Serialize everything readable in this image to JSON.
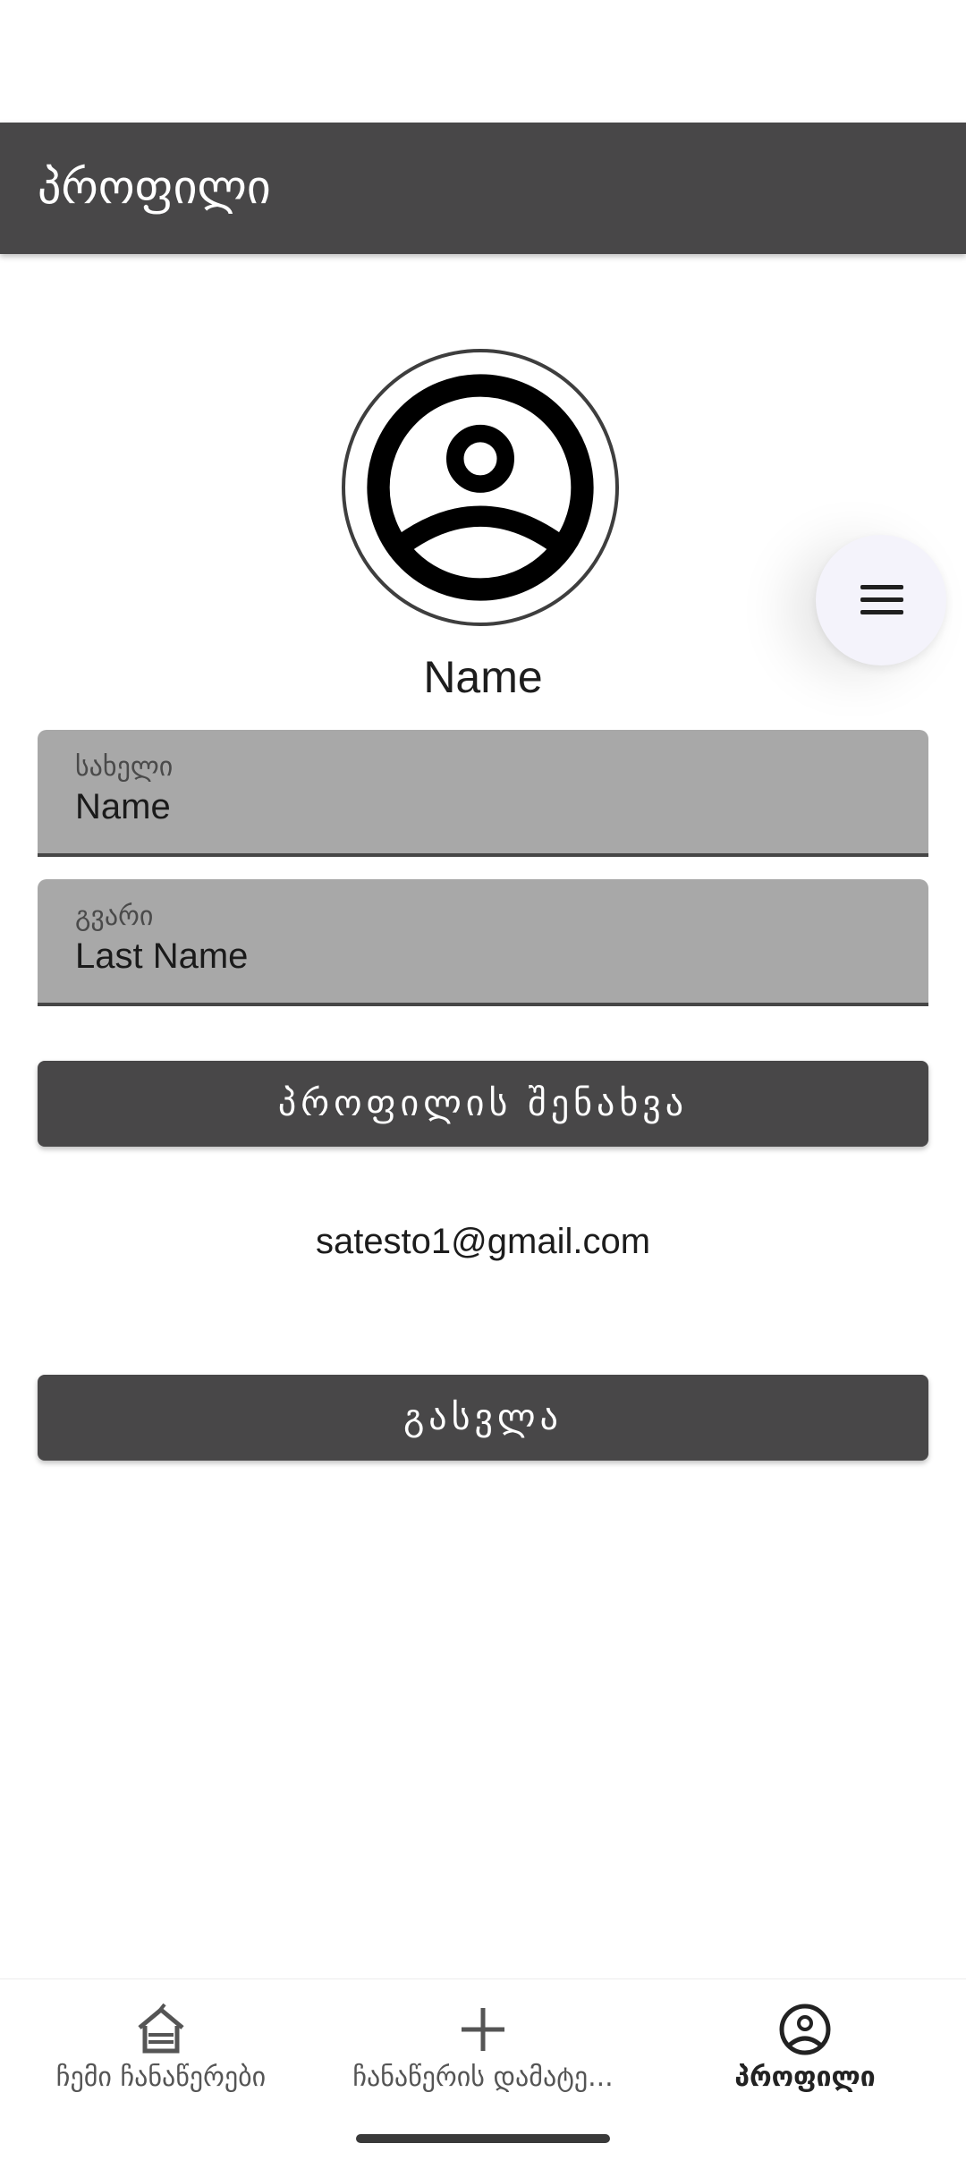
{
  "app_bar": {
    "title": "პროფილი"
  },
  "profile": {
    "display_name": "Name",
    "first_name": {
      "label": "სახელი",
      "value": "Name"
    },
    "last_name": {
      "label": "გვარი",
      "value": "Last Name"
    },
    "save_button_label": "პროფილის შენახვა",
    "email": "satesto1@gmail.com",
    "logout_button_label": "გასვლა"
  },
  "fab": {
    "icon": "menu-icon"
  },
  "bottom_nav": {
    "items": [
      {
        "label": "ჩემი ჩანაწერები",
        "icon": "home-icon",
        "active": false
      },
      {
        "label": "ჩანაწერის დამატე...",
        "icon": "add-icon",
        "active": false
      },
      {
        "label": "პროფილი",
        "icon": "account-circle-icon",
        "active": true
      }
    ]
  },
  "colors": {
    "app_bar": "#484748",
    "field_background": "#a8a8a8",
    "button": "#484748",
    "fab_background": "#f4f3fb"
  }
}
